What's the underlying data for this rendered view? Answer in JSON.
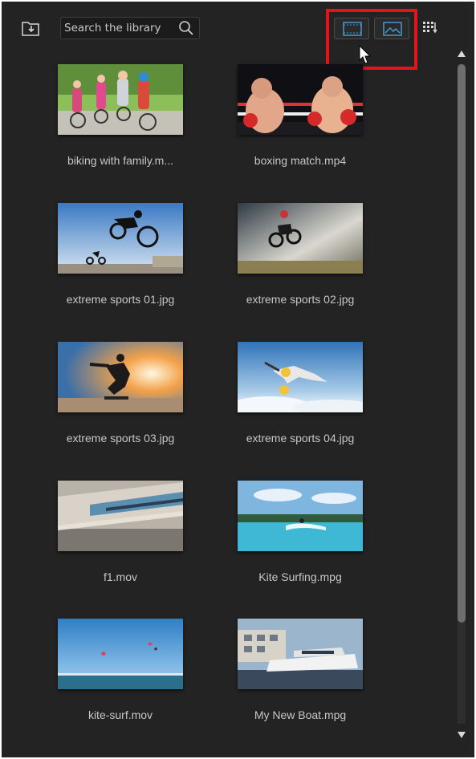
{
  "toolbar": {
    "import_icon": "import-media-icon",
    "search": {
      "placeholder": "Search the library",
      "value": "",
      "icon": "search-icon"
    },
    "view_buttons": [
      {
        "icon": "video-filter-icon",
        "state": "unselected"
      },
      {
        "icon": "image-filter-icon",
        "state": "unselected"
      }
    ],
    "sort_icon": "sort-view-icon"
  },
  "annotation": {
    "highlight_color": "#e3151a"
  },
  "library": {
    "items": [
      {
        "name": "biking with family.m...",
        "thumbnail": "family-biking-photo"
      },
      {
        "name": "boxing match.mp4",
        "thumbnail": "boxing-ring-photo"
      },
      {
        "name": "extreme sports 01.jpg",
        "thumbnail": "bmx-jump-photo"
      },
      {
        "name": "extreme sports 02.jpg",
        "thumbnail": "motocross-jump-photo"
      },
      {
        "name": "extreme sports 03.jpg",
        "thumbnail": "skateboard-sunset-photo"
      },
      {
        "name": "extreme sports 04.jpg",
        "thumbnail": "skydiver-photo"
      },
      {
        "name": "f1.mov",
        "thumbnail": "race-grandstand-photo"
      },
      {
        "name": "Kite Surfing.mpg",
        "thumbnail": "kite-surfing-photo"
      },
      {
        "name": "kite-surf.mov",
        "thumbnail": "kites-over-sea-photo"
      },
      {
        "name": "My New Boat.mpg",
        "thumbnail": "yacht-marina-photo"
      }
    ]
  },
  "colors": {
    "panel_bg": "#232323",
    "caption_text": "#c6c6c6",
    "accent_blue": "#4a9fd8"
  }
}
